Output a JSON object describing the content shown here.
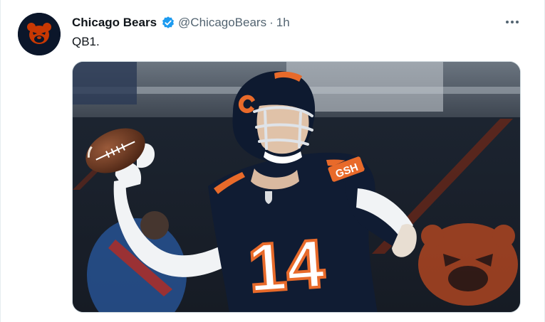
{
  "tweet": {
    "author": {
      "display_name": "Chicago Bears",
      "handle": "@ChicagoBears",
      "avatar_icon": "chicago-bears-logo",
      "verified": true
    },
    "separator": "·",
    "time": "1h",
    "text": "QB1.",
    "more_icon": "more-horizontal-icon",
    "media": {
      "jersey_number": "14",
      "sleeve_letters": "GSH"
    }
  },
  "colors": {
    "navy": "#0b162a",
    "orange": "#e64100",
    "verified_blue": "#1d9bf0",
    "muted_text": "#536471"
  }
}
